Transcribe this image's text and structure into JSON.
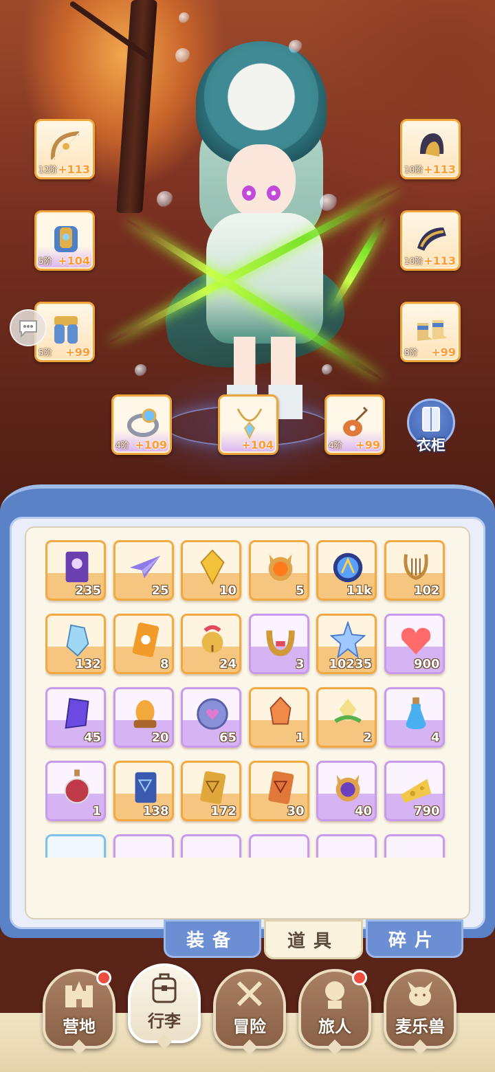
{
  "wardrobe": {
    "label": "衣柜",
    "icon": "wardrobe-icon"
  },
  "chat": {
    "icon": "chat-bubble-icon"
  },
  "equipment": [
    {
      "slot": "weapon-bow",
      "tier": "12阶",
      "bonus": "+113",
      "icon": "bow-icon"
    },
    {
      "slot": "armor",
      "tier": "5阶",
      "bonus": "+104",
      "icon": "armor-icon"
    },
    {
      "slot": "legs",
      "tier": "5阶",
      "bonus": "+99",
      "icon": "leg-armor-icon"
    },
    {
      "slot": "helmet",
      "tier": "10阶",
      "bonus": "+113",
      "icon": "helmet-icon"
    },
    {
      "slot": "gauntlet",
      "tier": "10阶",
      "bonus": "+113",
      "icon": "gauntlet-icon"
    },
    {
      "slot": "boots",
      "tier": "8阶",
      "bonus": "+99",
      "icon": "boots-icon"
    },
    {
      "slot": "ring",
      "tier": "4阶",
      "bonus": "+109",
      "icon": "ring-icon"
    },
    {
      "slot": "necklace",
      "tier": "",
      "bonus": "+104",
      "icon": "necklace-icon"
    },
    {
      "slot": "charm",
      "tier": "4阶",
      "bonus": "+99",
      "icon": "charm-icon"
    }
  ],
  "items": [
    {
      "icon": "ticket-icon",
      "count": "235",
      "rarity": "orange"
    },
    {
      "icon": "paper-plane-icon",
      "count": "25",
      "rarity": "orange"
    },
    {
      "icon": "yellow-gem-icon",
      "count": "10",
      "rarity": "orange"
    },
    {
      "icon": "cat-medal-icon",
      "count": "5",
      "rarity": "orange"
    },
    {
      "icon": "crystal-orb-icon",
      "count": "11k",
      "rarity": "orange"
    },
    {
      "icon": "lyre-icon",
      "count": "102",
      "rarity": "orange"
    },
    {
      "icon": "ice-crystal-icon",
      "count": "132",
      "rarity": "orange"
    },
    {
      "icon": "card-icon",
      "count": "8",
      "rarity": "orange"
    },
    {
      "icon": "bell-icon",
      "count": "24",
      "rarity": "orange"
    },
    {
      "icon": "horseshoe-icon",
      "count": "3",
      "rarity": "purple"
    },
    {
      "icon": "star-crystal-icon",
      "count": "10235",
      "rarity": "orange"
    },
    {
      "icon": "heart-icon",
      "count": "900",
      "rarity": "purple"
    },
    {
      "icon": "purple-gem-icon",
      "count": "45",
      "rarity": "purple"
    },
    {
      "icon": "amber-egg-icon",
      "count": "20",
      "rarity": "purple"
    },
    {
      "icon": "heart-coin-icon",
      "count": "65",
      "rarity": "purple"
    },
    {
      "icon": "fire-crystal-icon",
      "count": "1",
      "rarity": "orange"
    },
    {
      "icon": "nature-crystal-icon",
      "count": "2",
      "rarity": "orange"
    },
    {
      "icon": "blue-potion-icon",
      "count": "4",
      "rarity": "purple"
    },
    {
      "icon": "red-potion-icon",
      "count": "1",
      "rarity": "purple"
    },
    {
      "icon": "blue-card-icon",
      "count": "138",
      "rarity": "orange"
    },
    {
      "icon": "gold-card-icon",
      "count": "172",
      "rarity": "orange"
    },
    {
      "icon": "red-card-icon",
      "count": "30",
      "rarity": "orange"
    },
    {
      "icon": "purple-cat-medal-icon",
      "count": "40",
      "rarity": "purple"
    },
    {
      "icon": "cheese-icon",
      "count": "790",
      "rarity": "purple"
    },
    {
      "icon": "partial-item-icon",
      "count": "",
      "rarity": "blue"
    },
    {
      "icon": "partial-item-icon",
      "count": "",
      "rarity": "purple"
    },
    {
      "icon": "partial-item-icon",
      "count": "",
      "rarity": "purple"
    },
    {
      "icon": "partial-item-icon",
      "count": "",
      "rarity": "purple"
    },
    {
      "icon": "partial-item-icon",
      "count": "",
      "rarity": "purple"
    },
    {
      "icon": "partial-item-icon",
      "count": "",
      "rarity": "purple"
    }
  ],
  "tabs": {
    "equip": "装备",
    "items": "道具",
    "fragments": "碎片",
    "active": "道具"
  },
  "nav": [
    {
      "label": "营地",
      "icon": "castle-icon",
      "badge": true,
      "active": false
    },
    {
      "label": "行李",
      "icon": "backpack-icon",
      "badge": false,
      "active": true
    },
    {
      "label": "冒险",
      "icon": "crossed-swords-icon",
      "badge": false,
      "active": false
    },
    {
      "label": "旅人",
      "icon": "traveler-icon",
      "badge": true,
      "active": false
    },
    {
      "label": "麦乐兽",
      "icon": "cat-pet-icon",
      "badge": false,
      "active": false
    }
  ],
  "colors": {
    "orange_rarity": "#f2a941",
    "purple_rarity": "#c79af0",
    "blue_rarity": "#7fc0f0",
    "panel_blue": "#5b82c7",
    "badge_red": "#ef4d3d"
  }
}
